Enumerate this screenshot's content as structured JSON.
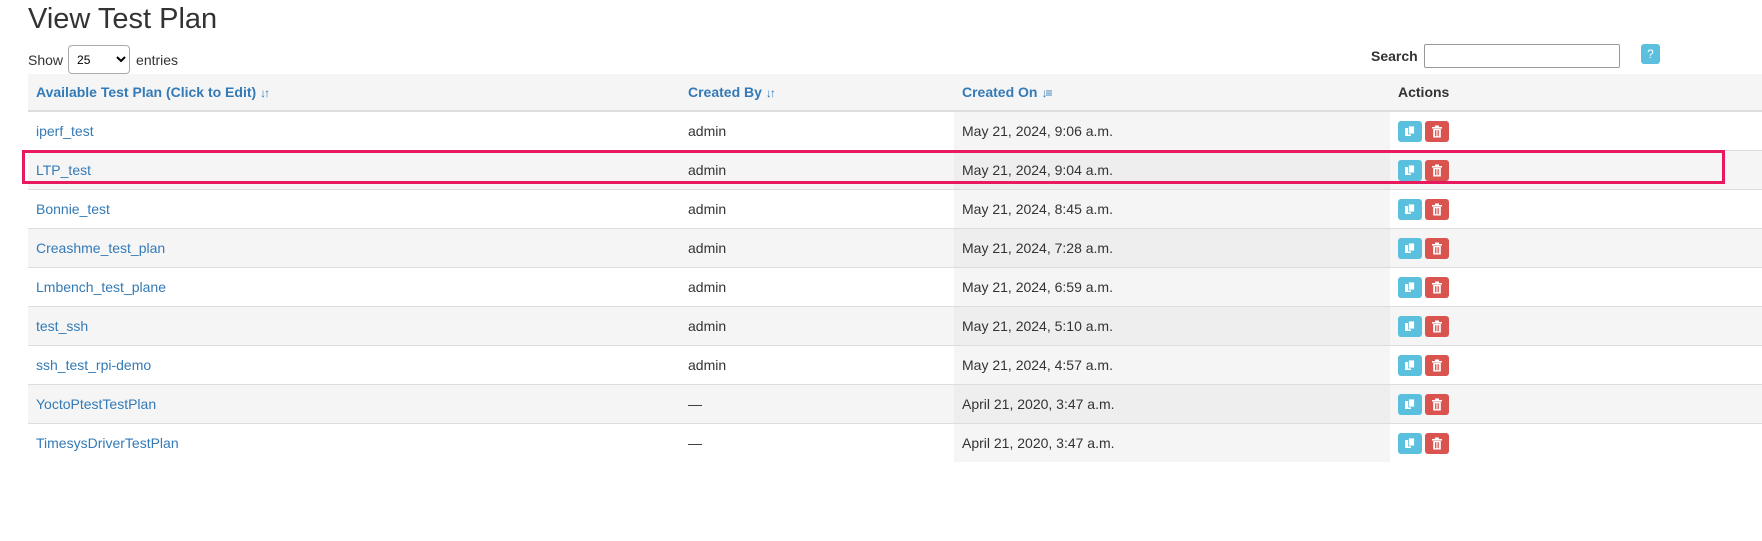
{
  "page": {
    "title": "View Test Plan"
  },
  "length": {
    "show_label": "Show",
    "selected": "25",
    "entries_label": "entries"
  },
  "search": {
    "label": "Search",
    "value": ""
  },
  "help": {
    "label": "?"
  },
  "table": {
    "headers": {
      "plan": "Available Test Plan (Click to Edit)",
      "created_by": "Created By",
      "created_on": "Created On",
      "actions": "Actions"
    },
    "rows": [
      {
        "name": "iperf_test",
        "created_by": "admin",
        "created_on": "May 21, 2024, 9:06 a.m."
      },
      {
        "name": "LTP_test",
        "created_by": "admin",
        "created_on": "May 21, 2024, 9:04 a.m."
      },
      {
        "name": "Bonnie_test",
        "created_by": "admin",
        "created_on": "May 21, 2024, 8:45 a.m."
      },
      {
        "name": "Creashme_test_plan",
        "created_by": "admin",
        "created_on": "May 21, 2024, 7:28 a.m."
      },
      {
        "name": "Lmbench_test_plane",
        "created_by": "admin",
        "created_on": "May 21, 2024, 6:59 a.m."
      },
      {
        "name": "test_ssh",
        "created_by": "admin",
        "created_on": "May 21, 2024, 5:10 a.m."
      },
      {
        "name": "ssh_test_rpi-demo",
        "created_by": "admin",
        "created_on": "May 21, 2024, 4:57 a.m."
      },
      {
        "name": "YoctoPtestTestPlan",
        "created_by": "—",
        "created_on": "April 21, 2020, 3:47 a.m."
      },
      {
        "name": "TimesysDriverTestPlan",
        "created_by": "—",
        "created_on": "April 21, 2020, 3:47 a.m."
      }
    ]
  },
  "icons": {
    "copy": "copy-icon",
    "delete": "trash-icon",
    "sort": "sort-icon"
  },
  "colors": {
    "link": "#337ab7",
    "copy_button": "#5bc0de",
    "delete_button": "#d9534f",
    "highlight": "#e8195c"
  }
}
